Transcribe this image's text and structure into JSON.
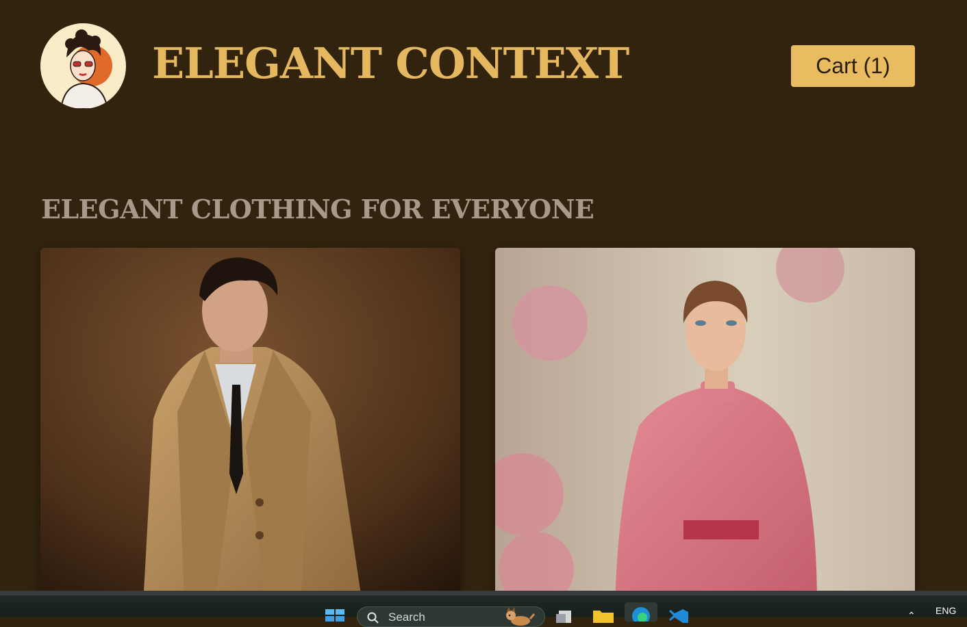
{
  "header": {
    "site_title": "ELEGANT CONTEXT",
    "cart_label": "Cart (1)",
    "logo_icon": "vintage-woman-sunglasses-logo"
  },
  "main": {
    "section_title": "ELEGANT CLOTHING FOR EVERYONE",
    "products": [
      {
        "image": "man-in-beige-trench-coat-photo"
      },
      {
        "image": "woman-in-pink-dress-photo"
      }
    ]
  },
  "taskbar": {
    "search_placeholder": "Search",
    "language": "ENG",
    "icons": [
      "windows-start-icon",
      "search-icon",
      "dog-icon",
      "file-explorer-icon",
      "folder-icon",
      "edge-icon",
      "vscode-icon",
      "chevron-up-icon"
    ]
  },
  "colors": {
    "background": "#31230e",
    "accent": "#e9bc61",
    "title": "#e5b860",
    "section_title": "#a8998a"
  }
}
